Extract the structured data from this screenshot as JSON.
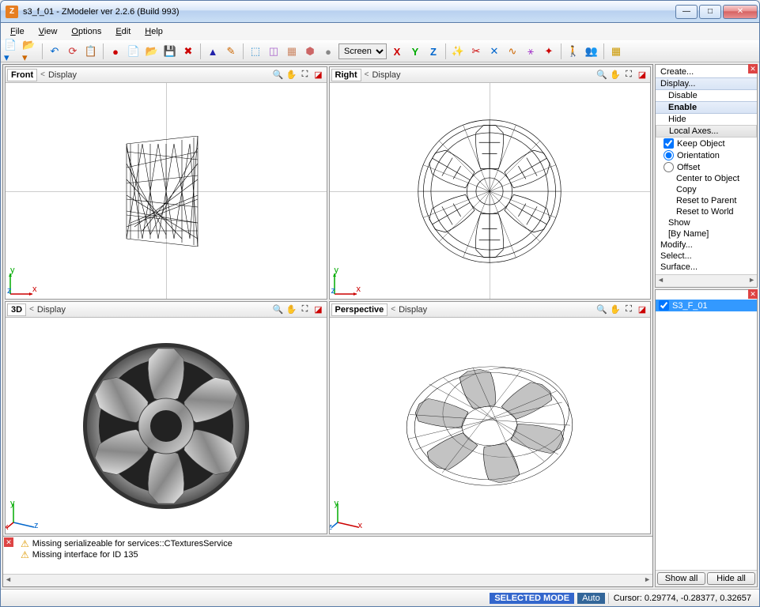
{
  "window": {
    "title": "s3_f_01 - ZModeler ver 2.2.6 (Build 993)"
  },
  "menu": {
    "file": "File",
    "view": "View",
    "options": "Options",
    "edit": "Edit",
    "help": "Help"
  },
  "toolbar": {
    "dropdown": "Screen",
    "axis_x": "X",
    "axis_y": "Y",
    "axis_z": "Z"
  },
  "viewports": {
    "front": {
      "name": "Front",
      "display": "Display",
      "nav": "<"
    },
    "right": {
      "name": "Right",
      "display": "Display",
      "nav": "<"
    },
    "threeD": {
      "name": "3D",
      "display": "Display",
      "nav": "<"
    },
    "perspective": {
      "name": "Perspective",
      "display": "Display",
      "nav": "<"
    }
  },
  "axes": {
    "x": "x",
    "y": "y",
    "z": "z"
  },
  "log": {
    "line1": "Missing serializeable for services::CTexturesService",
    "line2": "Missing interface for ID 135"
  },
  "sidebar": {
    "tree": {
      "create": "Create...",
      "display": "Display...",
      "disable": "Disable",
      "enable": "Enable",
      "hide": "Hide",
      "localAxes": "Local Axes...",
      "keepObject": "Keep Object",
      "orientation": "Orientation",
      "offset": "Offset",
      "centerToObject": "Center to Object",
      "copy": "Copy",
      "resetToParent": "Reset to Parent",
      "resetToWorld": "Reset to World",
      "show": "Show",
      "byName": "[By Name]",
      "modify": "Modify...",
      "select": "Select...",
      "surface": "Surface..."
    },
    "object": {
      "name": "S3_F_01"
    },
    "buttons": {
      "showAll": "Show all",
      "hideAll": "Hide all"
    }
  },
  "status": {
    "mode": "SELECTED MODE",
    "auto": "Auto",
    "cursor": "Cursor: 0.29774, -0.28377, 0.32657"
  }
}
